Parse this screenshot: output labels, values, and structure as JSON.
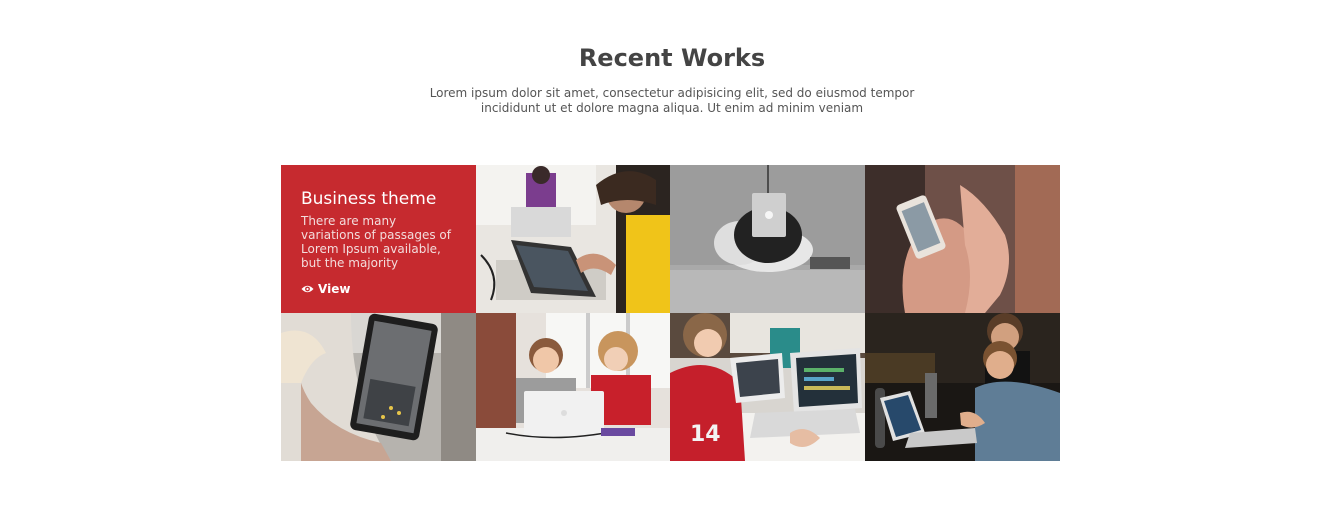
{
  "section": {
    "title": "Recent Works",
    "subtitle": "Lorem ipsum dolor sit amet, consectetur adipisicing elit, sed do eiusmod tempor incididunt ut et dolore magna aliqua. Ut enim ad minim veniam"
  },
  "featured": {
    "title": "Business theme",
    "description": "There are many variations of passages of Lorem Ipsum available, but the majority",
    "view_label": "View",
    "icon": "eye-icon",
    "color": "#c62a2f"
  },
  "gallery": {
    "photos": [
      {
        "name": "photo-designer-tablet"
      },
      {
        "name": "photo-laptop-beanbag"
      },
      {
        "name": "photo-smartphone-hands"
      },
      {
        "name": "photo-tablet-city"
      },
      {
        "name": "photo-kids-laptop"
      },
      {
        "name": "photo-boy-coding"
      },
      {
        "name": "photo-men-laptops"
      }
    ]
  }
}
